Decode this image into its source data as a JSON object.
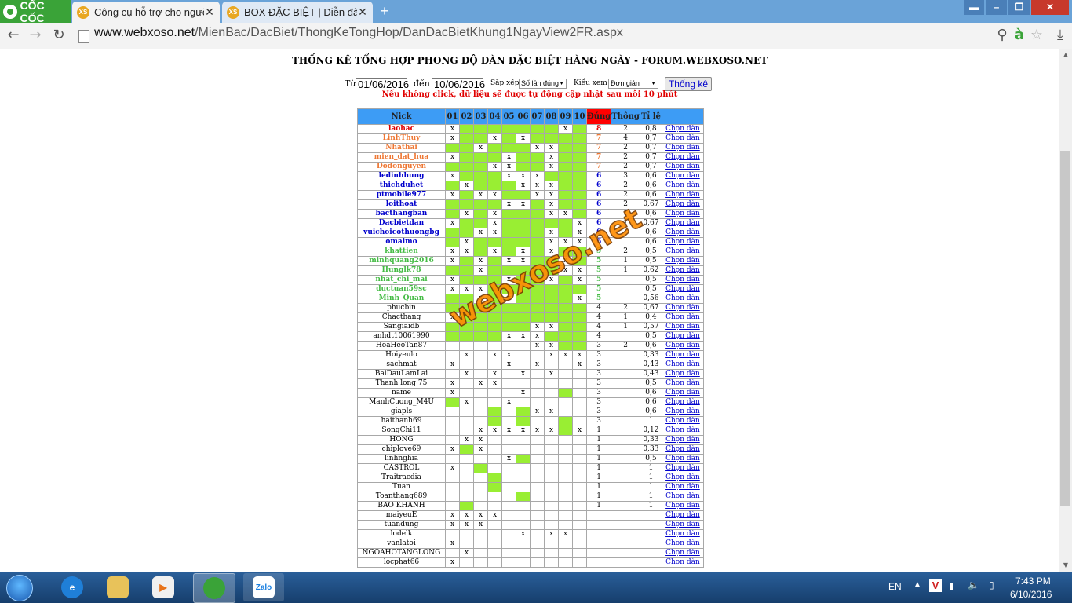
{
  "browser": {
    "brand": "CỐC CỐC",
    "tabs": [
      {
        "title": "Công cụ hỗ trợ cho người",
        "icon": "XS",
        "active": true
      },
      {
        "title": "BOX ĐẶC BIỆT | Diễn đàn",
        "icon": "XS",
        "active": false
      }
    ],
    "url_host": "www.webxoso.net",
    "url_path": "/MienBac/DacBiet/ThongKeTongHop/DanDacBietKhung1NgayView2FR.aspx"
  },
  "page": {
    "title": "THỐNG KÊ TỔNG HỢP PHONG ĐỘ DÀN ĐẶC BIỆT HÀNG NGÀY - FORUM.WEBXOSO.NET",
    "from_label": "Từ",
    "from_value": "01/06/2016",
    "to_label": "đến",
    "to_value": "10/06/2016",
    "sort_label": "Sắp xếp",
    "sort_value": "Số lần đúng",
    "view_label": "Kiểu xem",
    "view_value": "Đơn giản",
    "submit_label": "Thống kê",
    "notice": "Nếu không click, dữ liệu sẽ được tự động cập nhật sau mỗi 10 phút",
    "watermark": "webxoso.net"
  },
  "table": {
    "headers": {
      "nick": "Nick",
      "days": [
        "01",
        "02",
        "03",
        "04",
        "05",
        "06",
        "07",
        "08",
        "09",
        "10"
      ],
      "dung": "Đúng",
      "thong": "Thông",
      "tile": "Tỉ lệ"
    },
    "link_label": "Chọn dàn",
    "rows": [
      {
        "nick": "laohac",
        "m": "xgggggggxgg",
        "dung": "8",
        "thong": "2",
        "tile": "0,8"
      },
      {
        "nick": "LinhThuy",
        "m": "xggxgxggggg",
        "dung": "7",
        "thong": "4",
        "tile": "0,7"
      },
      {
        "nick": "Nhathai",
        "m": "ggxgggxxggg",
        "dung": "7",
        "thong": "2",
        "tile": "0,7"
      },
      {
        "nick": "mien_dat_hua",
        "m": "xgggxggxggg",
        "dung": "7",
        "thong": "2",
        "tile": "0,7"
      },
      {
        "nick": "Dodonguyen",
        "m": "gggxxggxggg",
        "dung": "7",
        "thong": "2",
        "tile": "0,7"
      },
      {
        "nick": "ledinhhung",
        "m": "xgggxxxgggg",
        "dung": "6",
        "thong": "3",
        "tile": "0,6"
      },
      {
        "nick": "thichduhet",
        "m": "gxgggxxxggg",
        "dung": "6",
        "thong": "2",
        "tile": "0,6"
      },
      {
        "nick": "ptmobile977",
        "m": "xgxxggxxggg",
        "dung": "6",
        "thong": "2",
        "tile": "0,6"
      },
      {
        "nick": "loithoat",
        "m": "ggggxxgxggg",
        "dung": "6",
        "thong": "2",
        "tile": "0,67"
      },
      {
        "nick": "bacthangban",
        "m": "gxgxgggxxgg",
        "dung": "6",
        "thong": "1",
        "tile": "0,6"
      },
      {
        "nick": "Dacbietdan",
        "m": "xggxgggggxg",
        "dung": "6",
        "thong": "1",
        "tile": "0,67"
      },
      {
        "nick": "vuichoicothuongbg",
        "m": "ggxxgggxgxg",
        "dung": "6",
        "thong": "",
        "tile": "0,6"
      },
      {
        "nick": "omaimo",
        "m": "gxgggggxxxg",
        "dung": "6",
        "thong": "",
        "tile": "0,6"
      },
      {
        "nick": "khattien",
        "m": "xxgxgxgxggg",
        "dung": "5",
        "thong": "2",
        "tile": "0,5"
      },
      {
        "nick": "minhquang2016",
        "m": "xgxgxxggxgg",
        "dung": "5",
        "thong": "1",
        "tile": "0,5"
      },
      {
        "nick": "Hunglk78",
        "m": "ggxgggggxxg",
        "dung": "5",
        "thong": "1",
        "tile": "0,62"
      },
      {
        "nick": "nhat_chi_mai",
        "m": "xgggxggxgxg",
        "dung": "5",
        "thong": "",
        "tile": "0,5"
      },
      {
        "nick": "ductuan59sc",
        "m": "xxxgggggggg",
        "dung": "5",
        "thong": "",
        "tile": "0,5"
      },
      {
        "nick": "Minh_Quan",
        "m": "ggxgxggggxg",
        "dung": "5",
        "thong": "",
        "tile": "0,56"
      },
      {
        "nick": "phucbin",
        "m": "gggggggggg",
        "dung": "4",
        "thong": "2",
        "tile": "0,67"
      },
      {
        "nick": "Chacthang",
        "m": "xggggggggg",
        "dung": "4",
        "thong": "1",
        "tile": "0,4"
      },
      {
        "nick": "Sangiaidb",
        "m": "ggggggxxgg",
        "dung": "4",
        "thong": "1",
        "tile": "0,57"
      },
      {
        "nick": "anhdt10061990",
        "m": "ggggxxxggg",
        "dung": "4",
        "thong": "",
        "tile": "0,5"
      },
      {
        "nick": "HoaHeoTan87",
        "m": "------xxgg",
        "dung": "3",
        "thong": "2",
        "tile": "0,6"
      },
      {
        "nick": "Hoiyeulo",
        "m": "-x-xx--xxx",
        "dung": "3",
        "thong": "",
        "tile": "0,33"
      },
      {
        "nick": "sachmat",
        "m": "x---x-x--x",
        "dung": "3",
        "thong": "",
        "tile": "0,43"
      },
      {
        "nick": "BaiDauLamLai",
        "m": "-x-x-x-x--",
        "dung": "3",
        "thong": "",
        "tile": "0,43"
      },
      {
        "nick": "Thanh long 75",
        "m": "x-xx------",
        "dung": "3",
        "thong": "",
        "tile": "0,5"
      },
      {
        "nick": "name",
        "m": "x----x--g-",
        "dung": "3",
        "thong": "",
        "tile": "0,6"
      },
      {
        "nick": "ManhCuong_M4U",
        "m": "gx--x-----",
        "dung": "3",
        "thong": "",
        "tile": "0,6"
      },
      {
        "nick": "giapls",
        "m": "---g-gxx--",
        "dung": "3",
        "thong": "",
        "tile": "0,6"
      },
      {
        "nick": "haithanh69",
        "m": "---g-g--g-",
        "dung": "3",
        "thong": "",
        "tile": "1"
      },
      {
        "nick": "SongChi11",
        "m": "--xxxxxxgx",
        "dung": "1",
        "thong": "",
        "tile": "0,12"
      },
      {
        "nick": "HONG",
        "m": "-xx-------",
        "dung": "1",
        "thong": "",
        "tile": "0,33"
      },
      {
        "nick": "chiplove69",
        "m": "xgx-------",
        "dung": "1",
        "thong": "",
        "tile": "0,33"
      },
      {
        "nick": "linhnghia",
        "m": "----xg----",
        "dung": "1",
        "thong": "",
        "tile": "0,5"
      },
      {
        "nick": "CASTROL",
        "m": "x-g-------",
        "dung": "1",
        "thong": "",
        "tile": "1"
      },
      {
        "nick": "Traitracdia",
        "m": "---g------",
        "dung": "1",
        "thong": "",
        "tile": "1"
      },
      {
        "nick": "Tuan",
        "m": "---g------",
        "dung": "1",
        "thong": "",
        "tile": "1"
      },
      {
        "nick": "Toanthang689",
        "m": "-----g----",
        "dung": "1",
        "thong": "",
        "tile": "1"
      },
      {
        "nick": "BAO KHANH",
        "m": "-g--------",
        "dung": "1",
        "thong": "",
        "tile": "1"
      },
      {
        "nick": "maiyeuE",
        "m": "xxxx------",
        "dung": "",
        "thong": "",
        "tile": ""
      },
      {
        "nick": "tuandung",
        "m": "xxx-------",
        "dung": "",
        "thong": "",
        "tile": ""
      },
      {
        "nick": "lodelk",
        "m": "-----x-xx-",
        "dung": "",
        "thong": "",
        "tile": ""
      },
      {
        "nick": "vanlatoi",
        "m": "x---------",
        "dung": "",
        "thong": "",
        "tile": ""
      },
      {
        "nick": "NGOAHOTANGLONG",
        "m": "-x--------",
        "dung": "",
        "thong": "",
        "tile": ""
      },
      {
        "nick": "locphat66",
        "m": "x---------",
        "dung": "",
        "thong": "",
        "tile": ""
      }
    ]
  },
  "taskbar": {
    "lang": "EN",
    "time": "7:43 PM",
    "date": "6/10/2016",
    "zalo": "Zalo"
  }
}
